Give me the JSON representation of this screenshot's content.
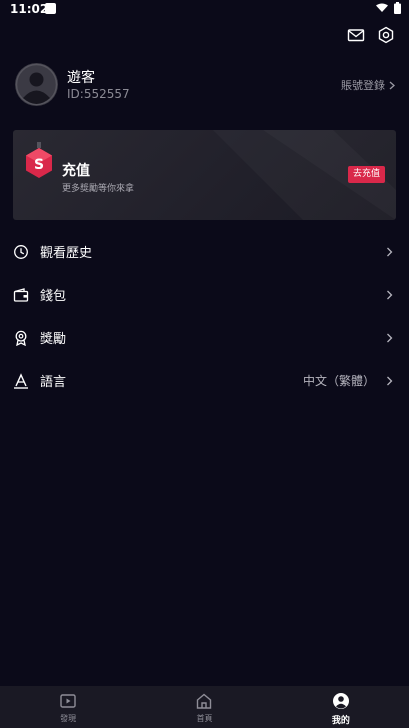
{
  "status": {
    "time": "11:02"
  },
  "profile": {
    "name": "遊客",
    "id": "ID:552557",
    "login_label": "賬號登錄"
  },
  "recharge": {
    "title": "充值",
    "subtitle": "更多獎勵等你來拿",
    "button": "去充值",
    "badge_letter": "S"
  },
  "menu": {
    "items": [
      {
        "label": "觀看歷史",
        "icon": "history-icon"
      },
      {
        "label": "錢包",
        "icon": "wallet-icon"
      },
      {
        "label": "獎勵",
        "icon": "reward-icon"
      },
      {
        "label": "語言",
        "icon": "language-icon",
        "value": "中文（繁體）"
      }
    ]
  },
  "nav": {
    "items": [
      {
        "label": "發現",
        "icon": "discover-icon",
        "active": false
      },
      {
        "label": "首頁",
        "icon": "home-icon",
        "active": false
      },
      {
        "label": "我的",
        "icon": "profile-icon",
        "active": true
      }
    ]
  },
  "colors": {
    "background": "#0b0a19",
    "accent": "#d9284a",
    "nav_bg": "#1a1924"
  }
}
